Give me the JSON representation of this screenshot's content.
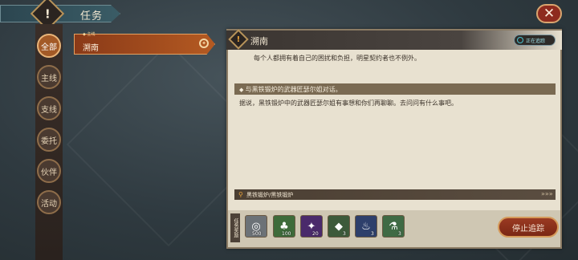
{
  "topbar": {
    "emblem_glyph": "!",
    "title": "任务",
    "close_glyph": "✕"
  },
  "tabs": [
    {
      "label": "全部",
      "active": true
    },
    {
      "label": "主线",
      "active": false
    },
    {
      "label": "支线",
      "active": false
    },
    {
      "label": "委托",
      "active": false
    },
    {
      "label": "伙伴",
      "active": false
    },
    {
      "label": "活动",
      "active": false
    }
  ],
  "quest_list": [
    {
      "tag": "主线",
      "title": "溯南",
      "selected": true
    }
  ],
  "detail": {
    "emblem_glyph": "!",
    "title": "溯南",
    "tracking_badge": "正在追踪",
    "quote": "每个人都拥有着自己的困扰和负担，明星契约者也不例外。",
    "objective": "与黑铁锻炉的武器匠瑟尔姐对话。",
    "objective_desc": "据说，黑铁锻炉中的武器匠瑟尔姐有事想和你们再聊聊。去问问有什么事吧。",
    "location": "黑铁锻炉/黑铁锻炉",
    "location_arrow": "»»»"
  },
  "rewards": {
    "label": "任务奖励",
    "items": [
      {
        "icon": "coin-icon",
        "glyph": "◎",
        "count": "500",
        "color": "#6c7277"
      },
      {
        "icon": "crystal-icon",
        "glyph": "♣",
        "count": "100",
        "color": "#3e6b3a"
      },
      {
        "icon": "purple-gem-icon",
        "glyph": "✦",
        "count": "20",
        "color": "#4a2a6b"
      },
      {
        "icon": "ore-icon",
        "glyph": "◆",
        "count": "3",
        "color": "#3d5a3a"
      },
      {
        "icon": "potion-icon",
        "glyph": "♨",
        "count": "3",
        "color": "#2e3f6b"
      },
      {
        "icon": "flask-icon",
        "glyph": "⚗",
        "count": "3",
        "color": "#3f6a44"
      }
    ]
  },
  "actions": {
    "stop_tracking": "停止追踪"
  }
}
